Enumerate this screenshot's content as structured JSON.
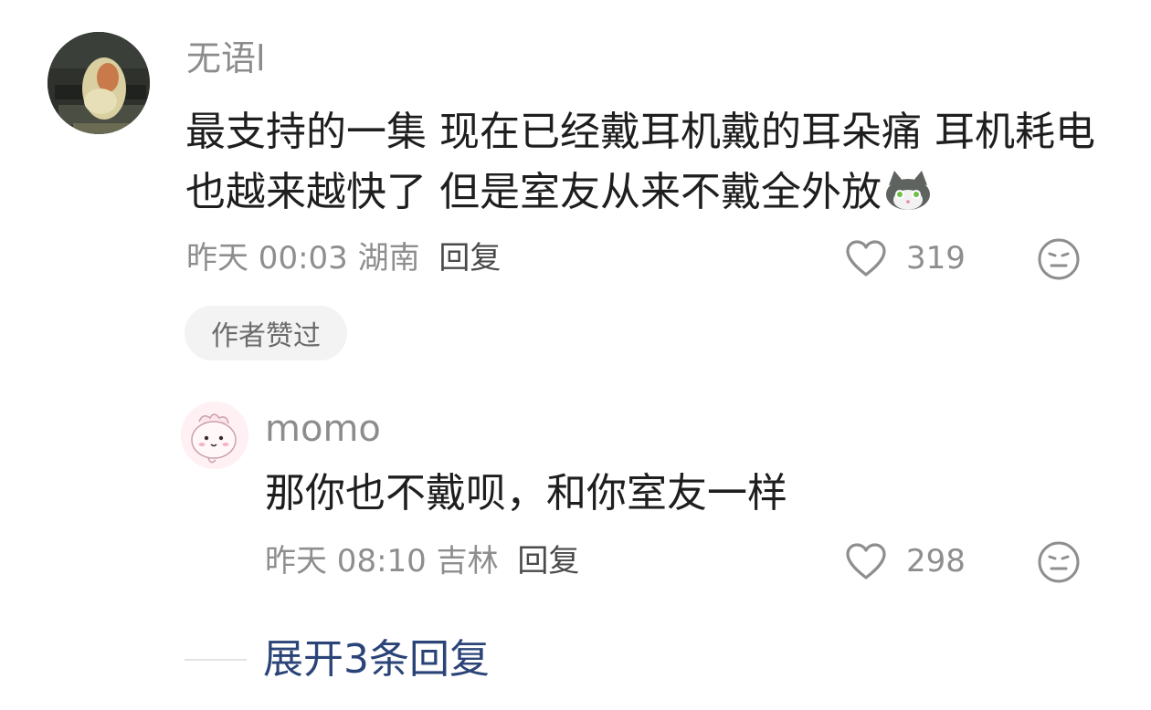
{
  "comment": {
    "username": "无语l",
    "text": "最支持的一集 现在已经戴耳机戴的耳朵痛 耳机耗电也越来越快了 但是室友从来不戴全外放",
    "sticker_icon": "gray-cat-sticker-icon",
    "time": "昨天 00:03",
    "location": "湖南",
    "reply_label": "回复",
    "likes": "319",
    "author_badge": "作者赞过"
  },
  "reply": {
    "username": "momo",
    "text": "那你也不戴呗，和你室友一样",
    "time": "昨天 08:10",
    "location": "吉林",
    "reply_label": "回复",
    "likes": "298"
  },
  "expand": {
    "label": "展开3条回复"
  },
  "colors": {
    "text_primary": "#1e1e1e",
    "text_secondary": "#8e8e8e",
    "link": "#2b4478",
    "badge_bg": "#f3f3f3"
  }
}
